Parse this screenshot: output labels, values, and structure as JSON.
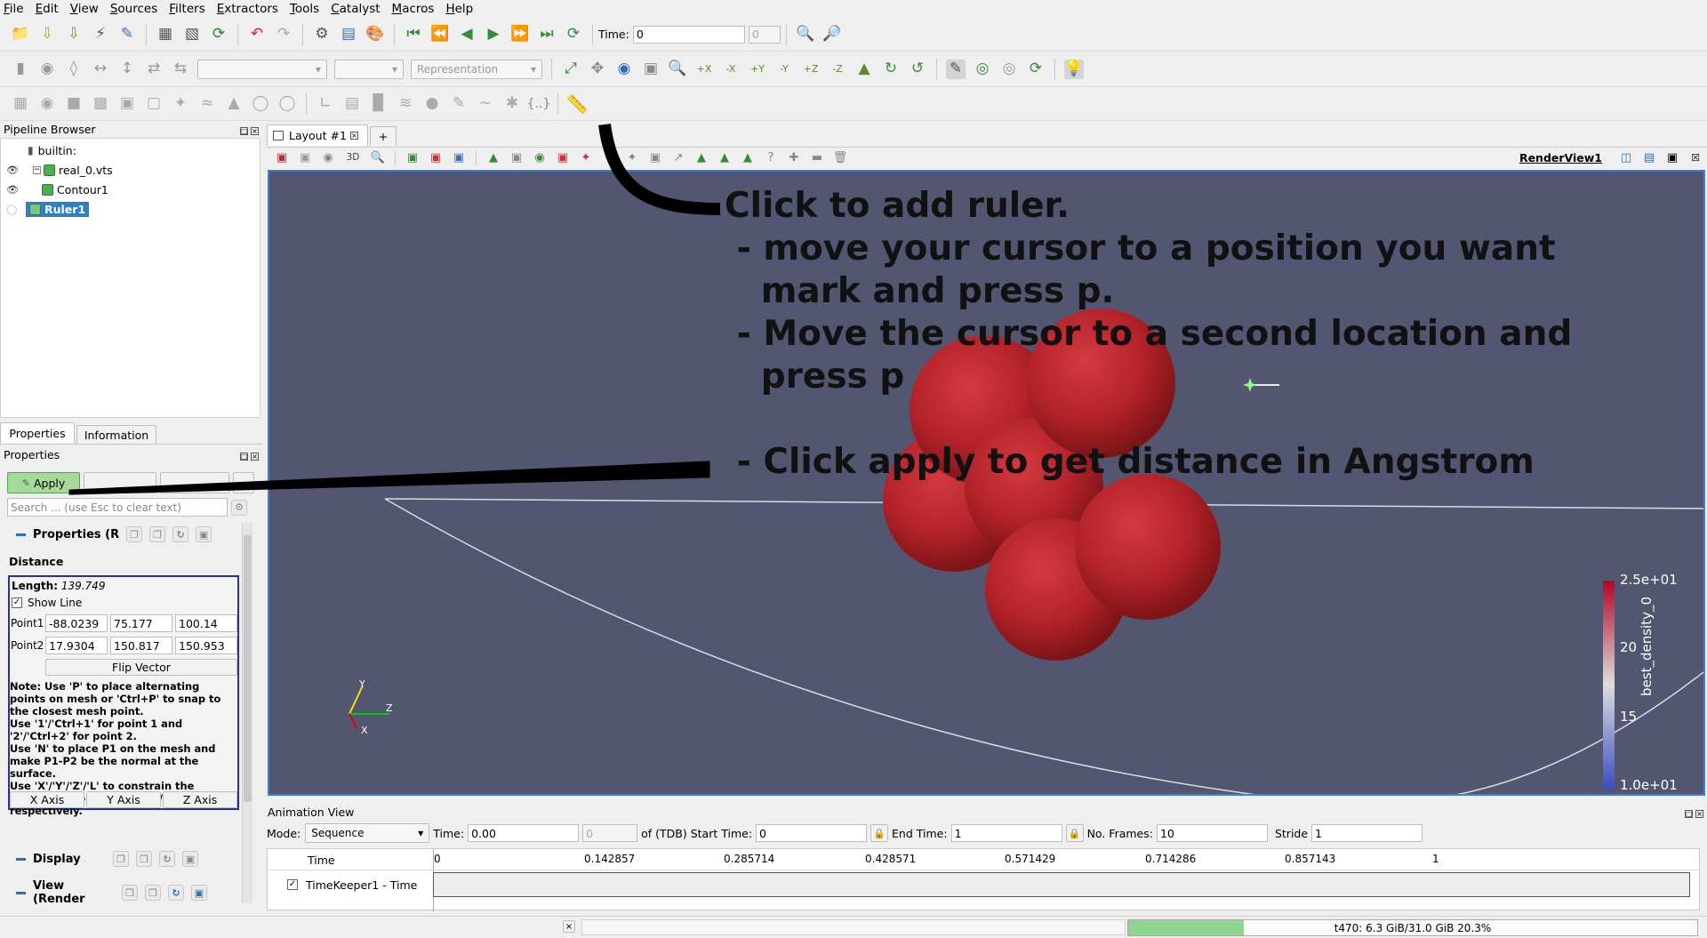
{
  "menu": [
    "File",
    "Edit",
    "View",
    "Sources",
    "Filters",
    "Extractors",
    "Tools",
    "Catalyst",
    "Macros",
    "Help"
  ],
  "toolbar": {
    "time_label": "Time:",
    "time_value": "0",
    "time_index": "0",
    "representation_placeholder": "Representation"
  },
  "pipeline": {
    "title": "Pipeline Browser",
    "root": "builtin:",
    "items": [
      "real_0.vts",
      "Contour1",
      "Ruler1"
    ]
  },
  "tabs": {
    "properties": "Properties",
    "information": "Information"
  },
  "properties": {
    "title": "Properties",
    "apply": "Apply",
    "search_placeholder": "Search ... (use Esc to clear text)",
    "section_properties": "Properties (R",
    "distance_header": "Distance",
    "length_label": "Length:",
    "length_value": "139.749",
    "show_line": "Show Line",
    "point1_label": "Point1",
    "point1": [
      "-88.0239",
      "75.177",
      "100.14"
    ],
    "point2_label": "Point2",
    "point2": [
      "17.9304",
      "150.817",
      "150.953"
    ],
    "flip_vector": "Flip Vector",
    "note": "Note: Use 'P' to place alternating points on mesh or 'Ctrl+P' to snap to the closest mesh point.\nUse '1'/'Ctrl+1' for point 1 and '2'/'Ctrl+2' for point 2.\nUse 'N' to place P1 on the mesh and make P1-P2 be the normal at the surface.\nUse 'X'/'Y'/'Z'/'L' to constrain the movement to the X / Y / Z / Line axis respectively.",
    "x_axis": "X Axis",
    "y_axis": "Y Axis",
    "z_axis": "Z Axis",
    "section_display": "Display",
    "section_view": "View (Render"
  },
  "layout": {
    "tab": "Layout #1",
    "add_tab": "+",
    "three_d": "3D",
    "render_view": "RenderView1"
  },
  "annotation": {
    "line1": "Click to add ruler.",
    "line2": " - move your cursor to a position you want",
    "line3": "   mark and press p.",
    "line4": " - Move the cursor to a second location and",
    "line5": "   press p",
    "line6": " - Click apply to get distance in Angstrom"
  },
  "colorbar": {
    "title": "best_density_0",
    "ticks": [
      "2.5e+01",
      "20",
      "15",
      "1.0e+01"
    ],
    "max_color": "#b40426",
    "mid_color": "#dddddd",
    "min_color": "#3b4cc0"
  },
  "orientation_axes": {
    "y": "Y",
    "z": "Z",
    "x": "X"
  },
  "animation": {
    "title": "Animation View",
    "mode_label": "Mode:",
    "mode_value": "Sequence",
    "time_label": "Time:",
    "time_value": "0.00",
    "time_index": "0",
    "of_tdb": "of (TDB)",
    "start_label": "Start Time:",
    "start_value": "0",
    "end_label": "End Time:",
    "end_value": "1",
    "frames_label": "No. Frames:",
    "frames_value": "10",
    "stride_label": "Stride",
    "stride_value": "1",
    "time_col": "Time",
    "ticks": [
      "0",
      "0.142857",
      "0.285714",
      "0.428571",
      "0.571429",
      "0.714286",
      "0.857143",
      "1"
    ],
    "track": "TimeKeeper1 - Time"
  },
  "status": {
    "memory": "t470: 6.3 GiB/31.0 GiB 20.3%",
    "memory_fraction": 0.203
  },
  "colors": {
    "viewport_bg": "#525670",
    "sphere": "#b3222a",
    "highlight": "#3f7fd1",
    "memory_bar": "#8fd48f"
  }
}
